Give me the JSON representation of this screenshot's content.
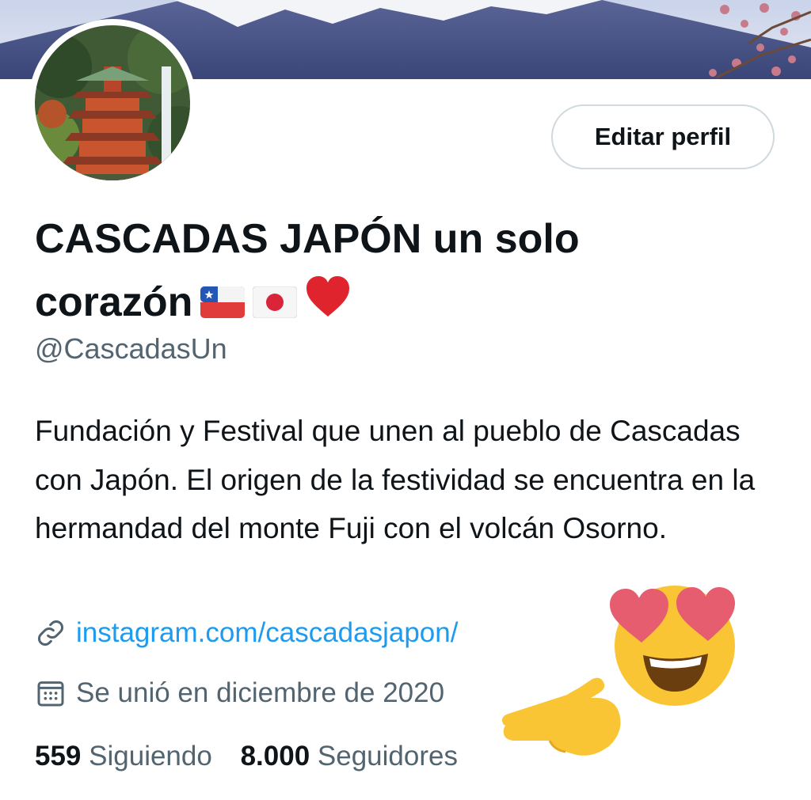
{
  "profile": {
    "display_name": "CASCADAS JAPÓN un solo corazón",
    "handle": "@CascadasUn",
    "bio": "Fundación y Festival que unen al pueblo de Cascadas con Japón. El origen de la festividad se encuentra en la hermandad del monte Fuji con el volcán Osorno.",
    "website": "instagram.com/cascadasjapon/",
    "joined": "Se unió en diciembre de 2020",
    "edit_button": "Editar perfil"
  },
  "stats": {
    "following_count": "559",
    "following_label": "Siguiendo",
    "followers_count": "8.000",
    "followers_label": "Seguidores"
  },
  "icons": [
    "link-icon",
    "calendar-icon",
    "chile-flag-icon",
    "japan-flag-icon",
    "red-heart-icon",
    "heart-eyes-emoji",
    "pointing-hand-emoji"
  ],
  "colors": {
    "link": "#1d9bf0",
    "secondary_text": "#536471",
    "primary_text": "#0f1419",
    "button_border": "#cfd9de"
  }
}
